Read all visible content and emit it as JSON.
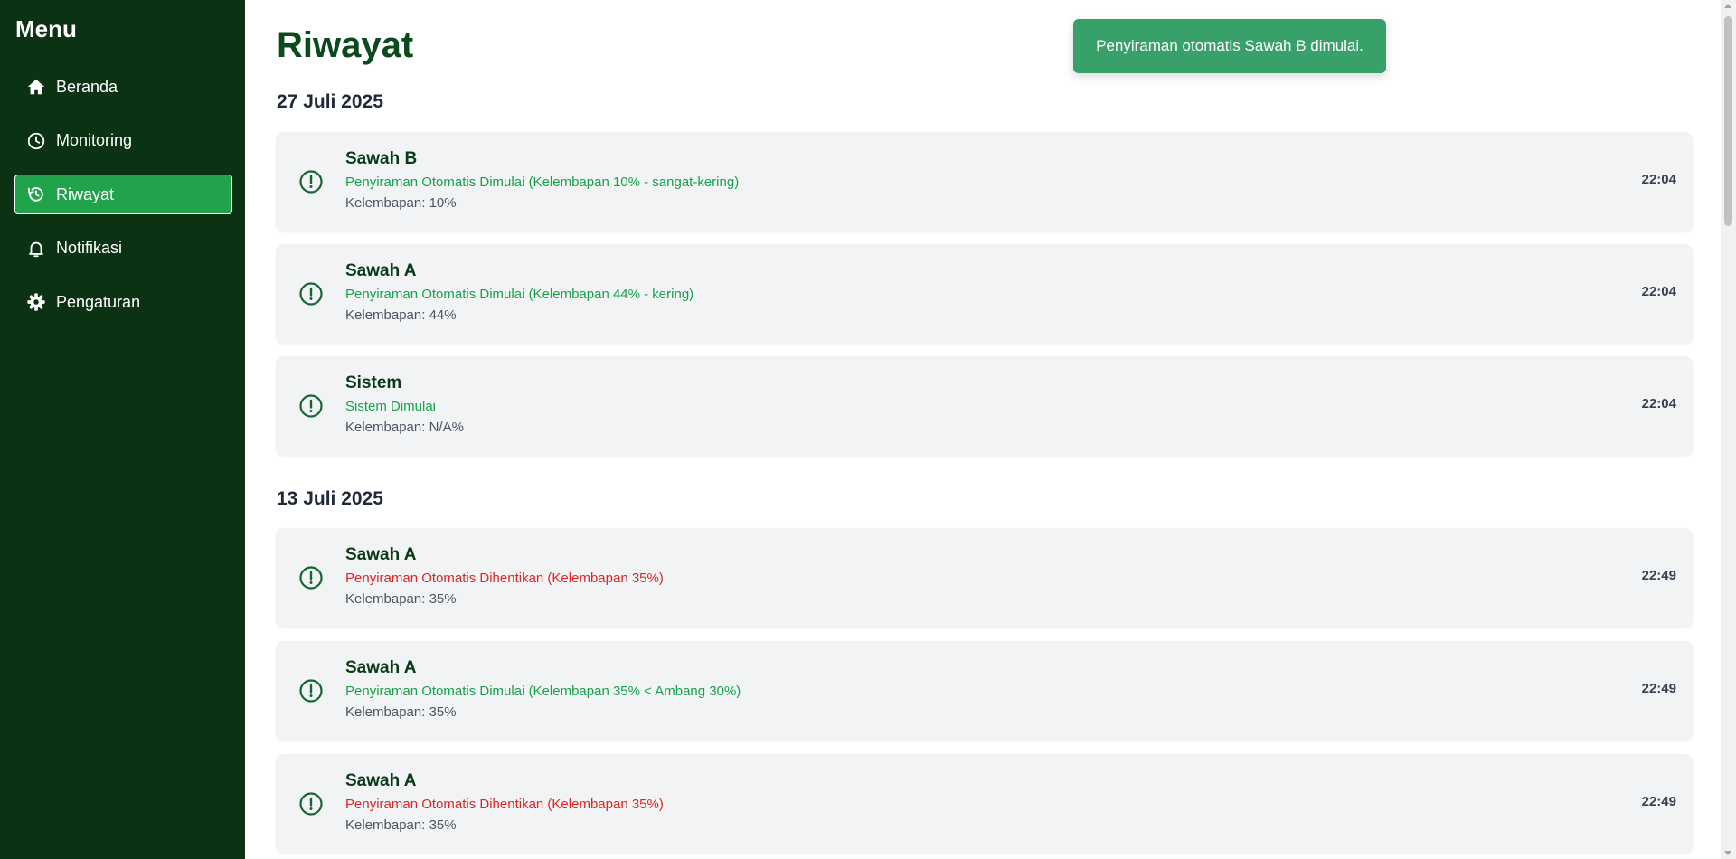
{
  "sidebar": {
    "title": "Menu",
    "items": [
      {
        "label": "Beranda",
        "icon": "home-icon"
      },
      {
        "label": "Monitoring",
        "icon": "clock-icon"
      },
      {
        "label": "Riwayat",
        "icon": "history-icon",
        "active": true
      },
      {
        "label": "Notifikasi",
        "icon": "bell-icon"
      },
      {
        "label": "Pengaturan",
        "icon": "gear-icon"
      }
    ]
  },
  "main": {
    "title": "Riwayat",
    "groups": [
      {
        "date": "27 Juli 2025",
        "entries": [
          {
            "source": "Sawah B",
            "message": "Penyiraman Otomatis Dimulai (Kelembapan 10% - sangat-kering)",
            "status": "green",
            "humidity": "Kelembapan: 10%",
            "time": "22:04"
          },
          {
            "source": "Sawah A",
            "message": "Penyiraman Otomatis Dimulai (Kelembapan 44% - kering)",
            "status": "green",
            "humidity": "Kelembapan: 44%",
            "time": "22:04"
          },
          {
            "source": "Sistem",
            "message": "Sistem Dimulai",
            "status": "green",
            "humidity": "Kelembapan: N/A%",
            "time": "22:04"
          }
        ]
      },
      {
        "date": "13 Juli 2025",
        "entries": [
          {
            "source": "Sawah A",
            "message": "Penyiraman Otomatis Dihentikan (Kelembapan 35%)",
            "status": "red",
            "humidity": "Kelembapan: 35%",
            "time": "22:49"
          },
          {
            "source": "Sawah A",
            "message": "Penyiraman Otomatis Dimulai (Kelembapan 35% < Ambang 30%)",
            "status": "green",
            "humidity": "Kelembapan: 35%",
            "time": "22:49"
          },
          {
            "source": "Sawah A",
            "message": "Penyiraman Otomatis Dihentikan (Kelembapan 35%)",
            "status": "red",
            "humidity": "Kelembapan: 35%",
            "time": "22:49"
          }
        ]
      }
    ]
  },
  "toast": {
    "message": "Penyiraman otomatis Sawah B dimulai."
  },
  "colors": {
    "sidebar_bg": "#0c3214",
    "active_bg": "#20a34a",
    "toast_bg": "#38a169",
    "success_text": "#16a34a",
    "error_text": "#dc2626"
  }
}
